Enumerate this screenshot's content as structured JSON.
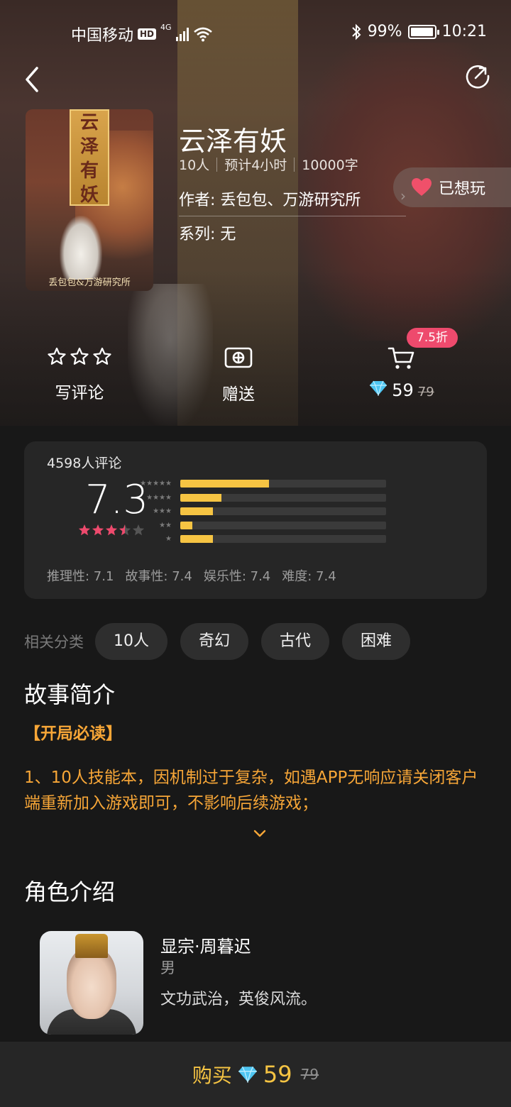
{
  "status_bar": {
    "carrier": "中国移动",
    "hd": "HD",
    "network": "4G",
    "battery": "99%",
    "time": "10:21"
  },
  "script": {
    "title": "云泽有妖",
    "players": "10人",
    "duration": "预计4小时",
    "words": "10000字",
    "author": "作者: 丢包包、万游研究所",
    "series": "系列:  无",
    "cover_banner": [
      "云",
      "泽",
      "有",
      "妖"
    ],
    "cover_caption": "丢包包&万游研究所"
  },
  "want_button": {
    "label": "已想玩"
  },
  "actions": {
    "review_label": "写评论",
    "gift_label": "赠送",
    "discount_badge": "7.5折",
    "price_now": "59",
    "price_old": "79"
  },
  "rating": {
    "count_text": "4598人评论",
    "score": "7.3",
    "stars": 3.5,
    "distribution": [
      {
        "stars": 5,
        "fraction": 0.43
      },
      {
        "stars": 4,
        "fraction": 0.2
      },
      {
        "stars": 3,
        "fraction": 0.16
      },
      {
        "stars": 2,
        "fraction": 0.06
      },
      {
        "stars": 1,
        "fraction": 0.16
      }
    ],
    "dims": [
      "推理性:  7.1",
      "故事性:  7.4",
      "娱乐性:  7.4",
      "难度:  7.4"
    ]
  },
  "tags": {
    "label": "相关分类",
    "items": [
      "10人",
      "奇幻",
      "古代",
      "困难"
    ]
  },
  "synopsis": {
    "heading": "故事简介",
    "must_read": "【开局必读】",
    "text": "1、10人技能本，因机制过于复杂，如遇APP无响应请关闭客户端重新加入游戏即可，不影响后续游戏；"
  },
  "characters": {
    "heading": "角色介绍",
    "items": [
      {
        "name": "显宗·周暮迟",
        "gender": "男",
        "desc": "文功武治，英俊风流。"
      }
    ]
  },
  "buy_bar": {
    "label": "购买",
    "price_now": "59",
    "price_old": "79"
  },
  "colors": {
    "accent_gold": "#f6c443",
    "accent_orange": "#f7a637",
    "accent_pink": "#ee4a6d",
    "background": "#181818"
  }
}
